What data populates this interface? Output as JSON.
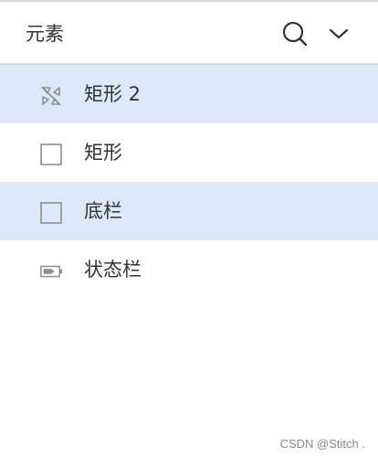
{
  "header": {
    "title": "元素",
    "search_icon": "search-icon",
    "dropdown_icon": "chevron-down-icon"
  },
  "layers": [
    {
      "label": "矩形 2",
      "icon": "hidden-shape-icon",
      "selected": true
    },
    {
      "label": "矩形",
      "icon": "rectangle-icon",
      "selected": false
    },
    {
      "label": "底栏",
      "icon": "rectangle-icon",
      "selected": true
    },
    {
      "label": "状态栏",
      "icon": "battery-icon",
      "selected": false
    }
  ],
  "watermark": "CSDN @Stitch .",
  "colors": {
    "selected_row": "#dce8fa",
    "icon_gray": "#8e8e8e",
    "text": "#333333"
  }
}
